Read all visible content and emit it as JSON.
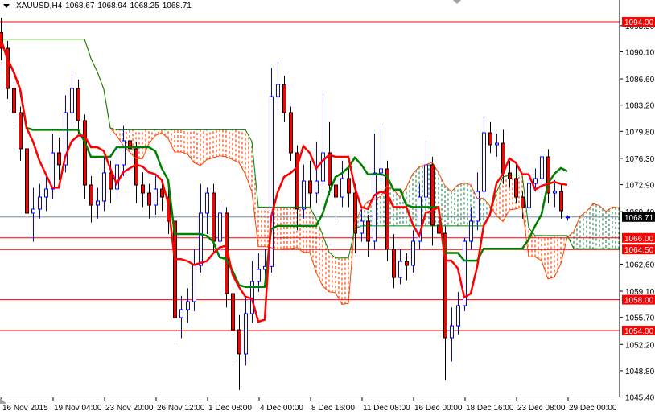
{
  "header": {
    "symbol": "XAUUSD,H4",
    "open": "1068.67",
    "high": "1068.94",
    "low": "1068.25",
    "close": "1068.71"
  },
  "colors": {
    "bull": "#0000ff",
    "bear": "#ff0000",
    "tenkan": "#ff0000",
    "kijun": "#008000",
    "cloud_bear": "#ff4500",
    "cloud_bull": "#2e8b57",
    "level": "#ff0000",
    "price_line": "#778899"
  },
  "chart_data": {
    "type": "candlestick",
    "title": "XAUUSD,H4",
    "xlabel": "",
    "ylabel": "",
    "ylim": [
      1045.4,
      1094.0
    ],
    "grid": false,
    "indicator": "Ichimoku Kinko Hyo",
    "y_ticks": [
      "1093.50",
      "1090.10",
      "1086.60",
      "1083.20",
      "1079.80",
      "1076.30",
      "1072.90",
      "1069.40",
      "1062.60",
      "1059.10",
      "1055.70",
      "1052.20",
      "1048.80",
      "1045.40"
    ],
    "x_ticks": [
      "16 Nov 2015",
      "19 Nov 04:00",
      "23 Nov 20:00",
      "26 Nov 12:00",
      "1 Dec 08:00",
      "4 Dec 00:00",
      "8 Dec 16:00",
      "11 Dec 08:00",
      "16 Dec 00:00",
      "18 Dec 16:00",
      "23 Dec 08:00",
      "29 Dec 00:00"
    ],
    "levels": [
      {
        "value": 1094.0,
        "label": "1094.00"
      },
      {
        "value": 1066.0,
        "label": "1066.00"
      },
      {
        "value": 1064.5,
        "label": "1064.50"
      },
      {
        "value": 1058.0,
        "label": "1058.00"
      },
      {
        "value": 1054.0,
        "label": "1054.00"
      }
    ],
    "current_price": {
      "value": 1068.71,
      "label": "1068.71"
    },
    "ohlc": [
      [
        1092.6,
        1094.5,
        1089.0,
        1090.56
      ],
      [
        1090.56,
        1091.5,
        1084.0,
        1085.35
      ],
      [
        1085.35,
        1086.5,
        1080.5,
        1082.23
      ],
      [
        1082.23,
        1083.0,
        1076.0,
        1077.54
      ],
      [
        1077.54,
        1078.5,
        1066.0,
        1069.21
      ],
      [
        1069.21,
        1072.5,
        1065.5,
        1069.73
      ],
      [
        1069.73,
        1073.0,
        1068.5,
        1071.29
      ],
      [
        1071.29,
        1074.0,
        1069.5,
        1072.33
      ],
      [
        1072.33,
        1079.5,
        1071.0,
        1077.02
      ],
      [
        1077.02,
        1079.0,
        1073.5,
        1075.46
      ],
      [
        1075.46,
        1084.5,
        1074.5,
        1082.23
      ],
      [
        1082.23,
        1087.5,
        1080.5,
        1085.35
      ],
      [
        1085.35,
        1086.5,
        1079.5,
        1081.19
      ],
      [
        1081.19,
        1082.0,
        1071.0,
        1072.85
      ],
      [
        1072.85,
        1074.0,
        1068.0,
        1070.25
      ],
      [
        1070.25,
        1072.5,
        1068.5,
        1070.77
      ],
      [
        1070.77,
        1076.5,
        1069.5,
        1074.42
      ],
      [
        1074.42,
        1076.0,
        1070.5,
        1072.33
      ],
      [
        1072.33,
        1078.0,
        1071.0,
        1075.46
      ],
      [
        1075.46,
        1080.5,
        1074.0,
        1078.58
      ],
      [
        1078.58,
        1080.0,
        1075.5,
        1077.54
      ],
      [
        1077.54,
        1078.5,
        1070.5,
        1072.85
      ],
      [
        1072.85,
        1074.5,
        1070.0,
        1071.81
      ],
      [
        1071.81,
        1073.0,
        1068.5,
        1070.25
      ],
      [
        1070.25,
        1074.0,
        1069.0,
        1072.33
      ],
      [
        1072.33,
        1073.5,
        1069.5,
        1071.29
      ],
      [
        1071.29,
        1072.5,
        1066.5,
        1068.17
      ],
      [
        1068.17,
        1069.0,
        1052.5,
        1055.67
      ],
      [
        1055.67,
        1058.5,
        1053.0,
        1056.71
      ],
      [
        1056.71,
        1059.5,
        1055.0,
        1057.75
      ],
      [
        1057.75,
        1064.5,
        1056.5,
        1062.44
      ],
      [
        1062.44,
        1073.0,
        1061.5,
        1069.21
      ],
      [
        1069.21,
        1072.5,
        1066.5,
        1071.81
      ],
      [
        1071.81,
        1073.0,
        1064.0,
        1065.56
      ],
      [
        1065.56,
        1070.5,
        1063.5,
        1069.21
      ],
      [
        1069.21,
        1070.0,
        1057.0,
        1058.79
      ],
      [
        1058.79,
        1060.0,
        1049.5,
        1054.1
      ],
      [
        1054.1,
        1056.0,
        1046.3,
        1050.98
      ],
      [
        1050.98,
        1058.5,
        1049.5,
        1056.19
      ],
      [
        1056.19,
        1063.0,
        1055.0,
        1060.35
      ],
      [
        1060.35,
        1064.0,
        1059.0,
        1061.92
      ],
      [
        1061.92,
        1064.5,
        1060.0,
        1062.3
      ],
      [
        1062.3,
        1088.0,
        1061.5,
        1084.31
      ],
      [
        1084.31,
        1088.8,
        1082.5,
        1085.87
      ],
      [
        1085.87,
        1087.0,
        1081.0,
        1082.23
      ],
      [
        1082.23,
        1083.0,
        1076.0,
        1077.02
      ],
      [
        1077.02,
        1078.0,
        1067.0,
        1069.73
      ],
      [
        1069.73,
        1075.5,
        1068.5,
        1073.37
      ],
      [
        1073.37,
        1076.0,
        1070.0,
        1071.81
      ],
      [
        1071.81,
        1078.5,
        1070.5,
        1073.37
      ],
      [
        1073.37,
        1085.0,
        1072.5,
        1077.02
      ],
      [
        1077.02,
        1081.0,
        1071.5,
        1072.85
      ],
      [
        1072.85,
        1074.0,
        1068.0,
        1071.29
      ],
      [
        1071.29,
        1076.0,
        1070.0,
        1073.69
      ],
      [
        1073.69,
        1075.0,
        1070.0,
        1071.81
      ],
      [
        1071.81,
        1073.0,
        1064.0,
        1066.6
      ],
      [
        1066.6,
        1070.0,
        1065.5,
        1068.17
      ],
      [
        1068.17,
        1069.0,
        1063.5,
        1065.56
      ],
      [
        1065.56,
        1079.5,
        1064.5,
        1074.42
      ],
      [
        1074.42,
        1080.5,
        1073.0,
        1074.94
      ],
      [
        1074.94,
        1076.0,
        1063.0,
        1064.52
      ],
      [
        1064.52,
        1066.5,
        1059.5,
        1060.87
      ],
      [
        1060.87,
        1064.5,
        1060.0,
        1062.96
      ],
      [
        1062.96,
        1064.0,
        1060.5,
        1062.44
      ],
      [
        1062.44,
        1067.0,
        1061.5,
        1065.56
      ],
      [
        1065.56,
        1073.0,
        1064.5,
        1071.29
      ],
      [
        1071.29,
        1078.5,
        1070.5,
        1075.46
      ],
      [
        1075.46,
        1076.5,
        1065.0,
        1067.65
      ],
      [
        1067.65,
        1069.0,
        1064.5,
        1066.6
      ],
      [
        1066.6,
        1067.5,
        1047.6,
        1053.06
      ],
      [
        1053.06,
        1057.0,
        1050.0,
        1054.62
      ],
      [
        1054.62,
        1059.0,
        1053.5,
        1057.23
      ],
      [
        1057.23,
        1066.0,
        1056.5,
        1065.56
      ],
      [
        1065.56,
        1070.0,
        1064.5,
        1068.17
      ],
      [
        1068.17,
        1074.5,
        1067.0,
        1072.02
      ],
      [
        1072.02,
        1081.6,
        1071.0,
        1079.62
      ],
      [
        1079.62,
        1081.0,
        1077.0,
        1078.06
      ],
      [
        1078.06,
        1079.5,
        1076.5,
        1078.27
      ],
      [
        1078.27,
        1080.0,
        1073.0,
        1074.42
      ],
      [
        1074.42,
        1076.0,
        1072.5,
        1073.69
      ],
      [
        1073.69,
        1075.5,
        1070.5,
        1071.29
      ],
      [
        1071.29,
        1072.0,
        1068.5,
        1069.94
      ],
      [
        1069.94,
        1074.5,
        1069.0,
        1073.06
      ],
      [
        1073.06,
        1075.0,
        1072.0,
        1073.69
      ],
      [
        1073.69,
        1077.0,
        1071.5,
        1076.5
      ],
      [
        1076.5,
        1077.5,
        1070.5,
        1071.81
      ],
      [
        1071.81,
        1073.5,
        1070.0,
        1072.02
      ],
      [
        1072.02,
        1073.0,
        1068.5,
        1069.52
      ],
      [
        1068.67,
        1068.94,
        1068.25,
        1068.71
      ]
    ]
  }
}
